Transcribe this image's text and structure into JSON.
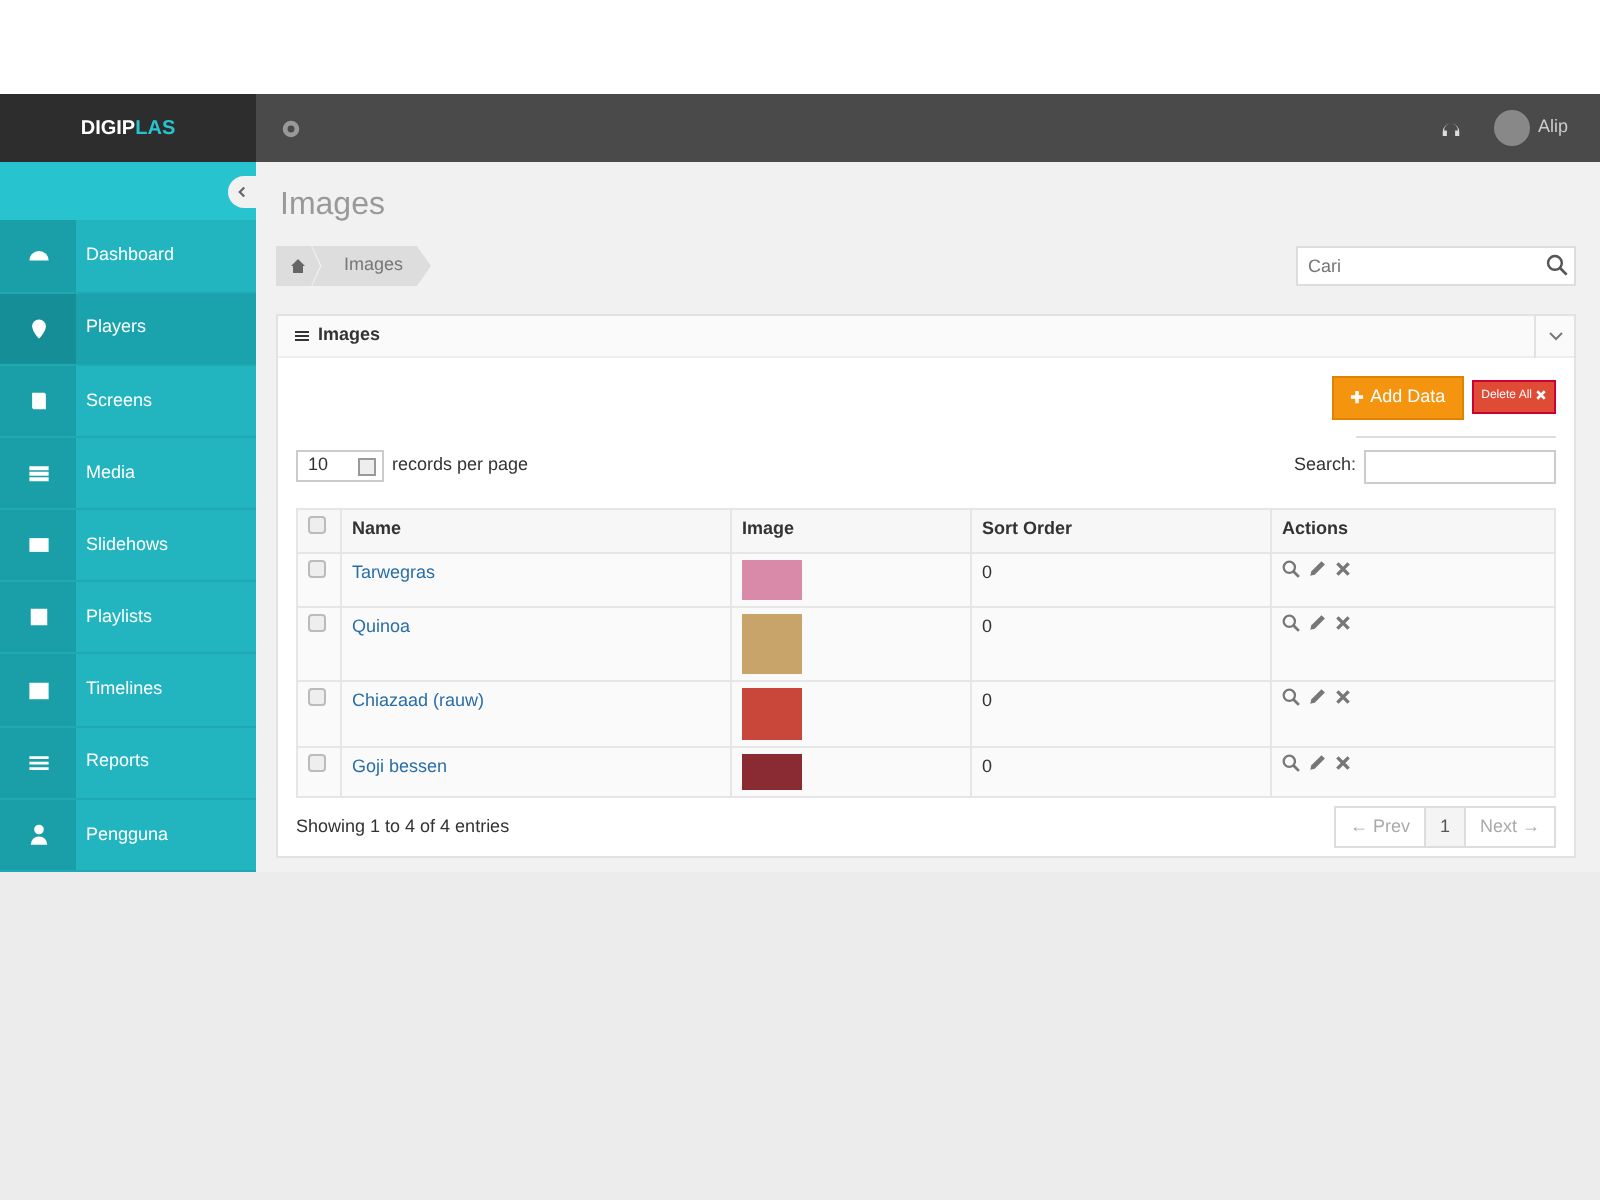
{
  "brand": {
    "part_1": "DIGIP",
    "part_2": "LAS"
  },
  "user": {
    "name": "Alip"
  },
  "sidebar": {
    "items": [
      {
        "label": "Dashboard",
        "selected": false
      },
      {
        "label": "Players",
        "selected": true
      },
      {
        "label": "Screens",
        "selected": false
      },
      {
        "label": "Media",
        "selected": false
      },
      {
        "label": "Slidehows",
        "selected": false
      },
      {
        "label": "Playlists",
        "selected": false
      },
      {
        "label": "Timelines",
        "selected": false
      },
      {
        "label": "Reports",
        "selected": false
      },
      {
        "label": "Pengguna",
        "selected": false
      }
    ]
  },
  "page_title": "Images",
  "breadcrumb": [
    "Images"
  ],
  "search": {
    "placeholder": "Cari"
  },
  "panel": {
    "title": "Images",
    "buttons": [
      {
        "label": "Add Data",
        "kind": "add"
      },
      {
        "label": "Delete All",
        "kind": "delete"
      }
    ],
    "page_size": "10",
    "page_size_label": "records per page",
    "search_label": "Search:",
    "table": {
      "columns": [
        "Name",
        "Image",
        "Sort Order",
        "Actions"
      ],
      "select_all_checked": false,
      "rows": [
        {
          "name": "Tarwegras",
          "sort_order": "0",
          "checked": false
        },
        {
          "name": "Quinoa",
          "sort_order": "0",
          "checked": false
        },
        {
          "name": "Chiazaad (rauw)",
          "sort_order": "0",
          "checked": false
        },
        {
          "name": "Goji bessen",
          "sort_order": "0",
          "checked": false
        }
      ]
    },
    "info": "Showing 1 to 4 of 4 entries",
    "pagination": [
      {
        "label": "← Prev",
        "disabled": true
      },
      {
        "label": "1",
        "disabled": false
      },
      {
        "label": "Next →",
        "disabled": true
      }
    ]
  }
}
